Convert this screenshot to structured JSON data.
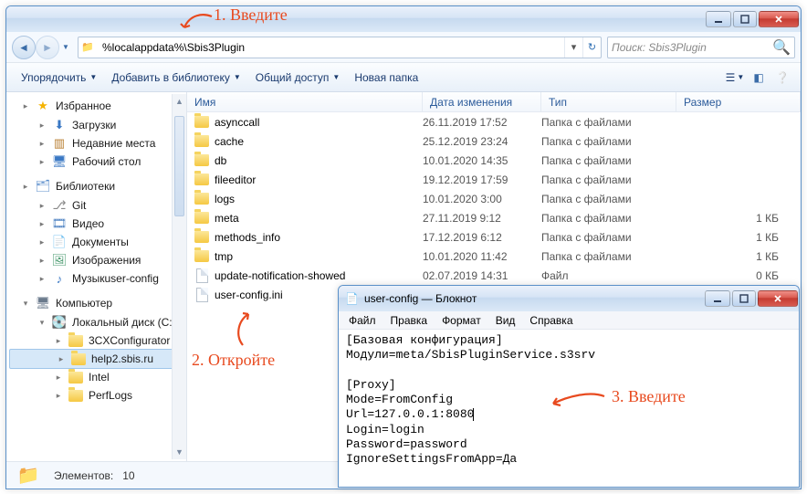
{
  "annotations": {
    "a1": "1. Введите",
    "a2": "2. Откройте",
    "a3": "3. Введите"
  },
  "explorer": {
    "address": "%localappdata%\\Sbis3Plugin",
    "searchPlaceholder": "Поиск: Sbis3Plugin",
    "commands": {
      "organize": "Упорядочить",
      "addToLib": "Добавить в библиотеку",
      "share": "Общий доступ",
      "newFolder": "Новая папка"
    },
    "columns": {
      "name": "Имя",
      "date": "Дата изменения",
      "type": "Тип",
      "size": "Размер"
    },
    "sidebar": {
      "groups": [
        {
          "label": "Избранное",
          "items": [
            {
              "label": "Загрузки"
            },
            {
              "label": "Недавние места"
            },
            {
              "label": "Рабочий стол"
            }
          ]
        },
        {
          "label": "Библиотеки",
          "items": [
            {
              "label": "Git"
            },
            {
              "label": "Видео"
            },
            {
              "label": "Документы"
            },
            {
              "label": "Изображения"
            },
            {
              "label": "Музыкuser-config"
            }
          ]
        },
        {
          "label": "Компьютер",
          "items": [
            {
              "label": "Локальный диск (C:)",
              "children": [
                {
                  "label": "3CXConfigurator"
                },
                {
                  "label": "help2.sbis.ru",
                  "selected": true
                },
                {
                  "label": "Intel"
                },
                {
                  "label": "PerfLogs"
                }
              ]
            }
          ]
        }
      ]
    },
    "rows": [
      {
        "name": "asynccall",
        "kind": "folder",
        "date": "26.11.2019 17:52",
        "type": "Папка с файлами",
        "size": ""
      },
      {
        "name": "cache",
        "kind": "folder",
        "date": "25.12.2019 23:24",
        "type": "Папка с файлами",
        "size": ""
      },
      {
        "name": "db",
        "kind": "folder",
        "date": "10.01.2020 14:35",
        "type": "Папка с файлами",
        "size": ""
      },
      {
        "name": "fileeditor",
        "kind": "folder",
        "date": "19.12.2019 17:59",
        "type": "Папка с файлами",
        "size": ""
      },
      {
        "name": "logs",
        "kind": "folder",
        "date": "10.01.2020 3:00",
        "type": "Папка с файлами",
        "size": ""
      },
      {
        "name": "meta",
        "kind": "folder",
        "date": "27.11.2019 9:12",
        "type": "Папка с файлами",
        "size": "1 КБ"
      },
      {
        "name": "methods_info",
        "kind": "folder",
        "date": "17.12.2019 6:12",
        "type": "Папка с файлами",
        "size": "1 КБ"
      },
      {
        "name": "tmp",
        "kind": "folder",
        "date": "10.01.2020 11:42",
        "type": "Папка с файлами",
        "size": "1 КБ"
      },
      {
        "name": "update-notification-showed",
        "kind": "file",
        "date": "02.07.2019 14:31",
        "type": "Файл",
        "size": "0 КБ"
      },
      {
        "name": "user-config.ini",
        "kind": "file",
        "date": "",
        "type": "",
        "size": ""
      }
    ],
    "status": {
      "label": "Элементов:",
      "count": "10"
    }
  },
  "notepad": {
    "title": "user-config — Блокнот",
    "menu": [
      "Файл",
      "Правка",
      "Формат",
      "Вид",
      "Справка"
    ],
    "lines": [
      "[Базовая конфигурация]",
      "Модули=meta/SbisPluginService.s3srv",
      "",
      "[Proxy]",
      "Mode=FromConfig",
      "Url=127.0.0.1:8080",
      "Login=login",
      "Password=password",
      "IgnoreSettingsFromApp=Да"
    ]
  }
}
